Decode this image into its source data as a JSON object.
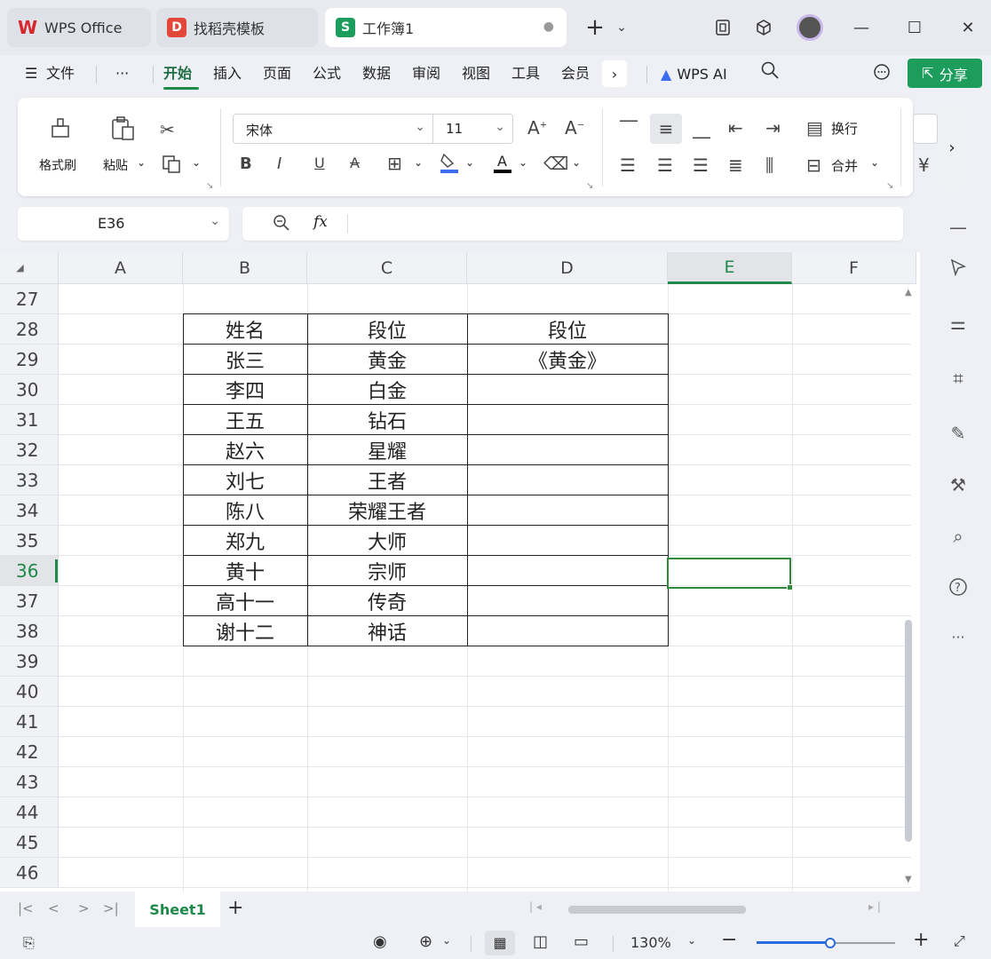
{
  "tabs": [
    {
      "label": "WPS Office",
      "logo": "W",
      "color": "#d6282c"
    },
    {
      "label": "找稻壳模板",
      "logo": "D",
      "color": "#e2473a"
    },
    {
      "label": "工作簿1",
      "logo": "S",
      "color": "#1d9d5c"
    }
  ],
  "menu": [
    "文件",
    "开始",
    "插入",
    "页面",
    "公式",
    "数据",
    "审阅",
    "视图",
    "工具",
    "会员"
  ],
  "menu_more": "···",
  "wps_ai": "WPS AI",
  "share": "分享",
  "ribbon": {
    "format_painter": "格式刷",
    "paste": "粘贴",
    "font_name": "宋体",
    "font_size": "11",
    "wrap": "换行",
    "merge": "合并"
  },
  "formula": {
    "cell_ref": "E36",
    "fx": "fx",
    "value": ""
  },
  "columns": [
    "A",
    "B",
    "C",
    "D",
    "E",
    "F"
  ],
  "rows": [
    "27",
    "28",
    "29",
    "30",
    "31",
    "32",
    "33",
    "34",
    "35",
    "36",
    "37",
    "38",
    "39",
    "40",
    "41",
    "42",
    "43",
    "44",
    "45",
    "46"
  ],
  "selected_row": "36",
  "selected_col": "E",
  "table": {
    "headers": [
      "姓名",
      "段位",
      "段位"
    ],
    "rows": [
      [
        "张三",
        "黄金",
        "《黄金》"
      ],
      [
        "李四",
        "白金",
        ""
      ],
      [
        "王五",
        "钻石",
        ""
      ],
      [
        "赵六",
        "星耀",
        ""
      ],
      [
        "刘七",
        "王者",
        ""
      ],
      [
        "陈八",
        "荣耀王者",
        ""
      ],
      [
        "郑九",
        "大师",
        ""
      ],
      [
        "黄十",
        "宗师",
        ""
      ],
      [
        "高十一",
        "传奇",
        ""
      ],
      [
        "谢十二",
        "神话",
        ""
      ]
    ]
  },
  "sheet": {
    "active": "Sheet1",
    "add": "+"
  },
  "status": {
    "zoom": "130%",
    "zoom_level": 0.53
  },
  "colors": {
    "accent": "#1f8a4c",
    "share_bg": "#1d9d5c",
    "selection": "#2e8b3a"
  }
}
